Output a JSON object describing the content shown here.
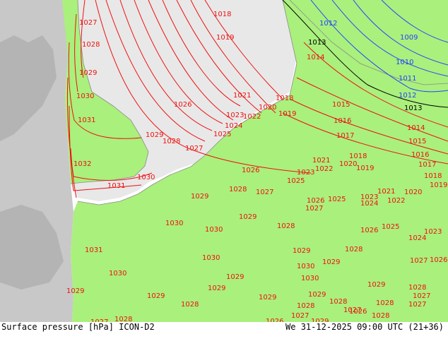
{
  "footer": {
    "title": "Surface pressure [hPa] ICON-D2",
    "valid_time": "We 31-12-2025 09:00 UTC (21+36)"
  },
  "colors": {
    "land": "#aaf07c",
    "sea": "#e8e8e8",
    "outside_domain": "#c8c8c8",
    "coastline": "#8a8a8a",
    "isobar_red": "#ee1111",
    "isobar_blue": "#2244ff",
    "isobar_black": "#000000"
  },
  "isobars": [
    {
      "value": "1027",
      "color": "red"
    },
    {
      "value": "1028",
      "color": "red"
    },
    {
      "value": "1029",
      "color": "red"
    },
    {
      "value": "1030",
      "color": "red"
    },
    {
      "value": "1031",
      "color": "red"
    },
    {
      "value": "1032",
      "color": "red"
    },
    {
      "value": "1018",
      "color": "red"
    },
    {
      "value": "1019",
      "color": "red"
    },
    {
      "value": "1020",
      "color": "red"
    },
    {
      "value": "1021",
      "color": "red"
    },
    {
      "value": "1022",
      "color": "red"
    },
    {
      "value": "1023",
      "color": "red"
    },
    {
      "value": "1024",
      "color": "red"
    },
    {
      "value": "1025",
      "color": "red"
    },
    {
      "value": "1026",
      "color": "red"
    },
    {
      "value": "1014",
      "color": "red"
    },
    {
      "value": "1015",
      "color": "red"
    },
    {
      "value": "1016",
      "color": "red"
    },
    {
      "value": "1017",
      "color": "red"
    },
    {
      "value": "1013",
      "color": "black"
    },
    {
      "value": "1012",
      "color": "blue"
    },
    {
      "value": "1011",
      "color": "blue"
    },
    {
      "value": "1010",
      "color": "blue"
    },
    {
      "value": "1009",
      "color": "blue"
    }
  ],
  "labels": [
    {
      "text": "1027"
    },
    {
      "text": "1028"
    },
    {
      "text": "1029"
    },
    {
      "text": "1030"
    },
    {
      "text": "1031"
    },
    {
      "text": "1032"
    },
    {
      "text": "1031"
    },
    {
      "text": "1018"
    },
    {
      "text": "1019"
    },
    {
      "text": "1026"
    },
    {
      "text": "1021"
    },
    {
      "text": "1018"
    },
    {
      "text": "1020"
    },
    {
      "text": "1019"
    },
    {
      "text": "1023"
    },
    {
      "text": "1022"
    },
    {
      "text": "1024"
    },
    {
      "text": "1025"
    },
    {
      "text": "1029"
    },
    {
      "text": "1028"
    },
    {
      "text": "1027"
    },
    {
      "text": "1030"
    },
    {
      "text": "1026"
    },
    {
      "text": "1025"
    },
    {
      "text": "1023"
    },
    {
      "text": "1022"
    },
    {
      "text": "1021"
    },
    {
      "text": "1020"
    },
    {
      "text": "1019"
    },
    {
      "text": "1018"
    },
    {
      "text": "1017"
    },
    {
      "text": "1016"
    },
    {
      "text": "1015"
    },
    {
      "text": "1014"
    },
    {
      "text": "1015"
    },
    {
      "text": "1016"
    },
    {
      "text": "1017"
    },
    {
      "text": "1018"
    },
    {
      "text": "1019"
    },
    {
      "text": "1029"
    },
    {
      "text": "1028"
    },
    {
      "text": "1027"
    },
    {
      "text": "1026"
    },
    {
      "text": "1027"
    },
    {
      "text": "1025"
    },
    {
      "text": "1024"
    },
    {
      "text": "1023"
    },
    {
      "text": "1022"
    },
    {
      "text": "1021"
    },
    {
      "text": "1020"
    },
    {
      "text": "1029"
    },
    {
      "text": "1030"
    },
    {
      "text": "1030"
    },
    {
      "text": "1031"
    },
    {
      "text": "1030"
    },
    {
      "text": "1030"
    },
    {
      "text": "1029"
    },
    {
      "text": "1029"
    },
    {
      "text": "1029"
    },
    {
      "text": "1028"
    },
    {
      "text": "1027"
    },
    {
      "text": "1028"
    },
    {
      "text": "1026"
    },
    {
      "text": "1025"
    },
    {
      "text": "1024"
    },
    {
      "text": "1023"
    },
    {
      "text": "1027"
    },
    {
      "text": "1026"
    },
    {
      "text": "1028"
    },
    {
      "text": "1029"
    },
    {
      "text": "1028"
    },
    {
      "text": "1029"
    },
    {
      "text": "1030"
    },
    {
      "text": "1029"
    },
    {
      "text": "1029"
    },
    {
      "text": "1030"
    },
    {
      "text": "1029"
    },
    {
      "text": "1028"
    },
    {
      "text": "1027"
    },
    {
      "text": "1028"
    },
    {
      "text": "1029"
    },
    {
      "text": "1027"
    },
    {
      "text": "1026"
    },
    {
      "text": "1028"
    },
    {
      "text": "1027"
    },
    {
      "text": "1028"
    },
    {
      "text": "1027"
    },
    {
      "text": "1026"
    },
    {
      "text": "1029"
    },
    {
      "text": "1028"
    },
    {
      "text": "1014"
    },
    {
      "text": "1013"
    },
    {
      "text": "1013"
    },
    {
      "text": "1012"
    },
    {
      "text": "1011"
    },
    {
      "text": "1010"
    },
    {
      "text": "1009"
    },
    {
      "text": "1012"
    }
  ]
}
